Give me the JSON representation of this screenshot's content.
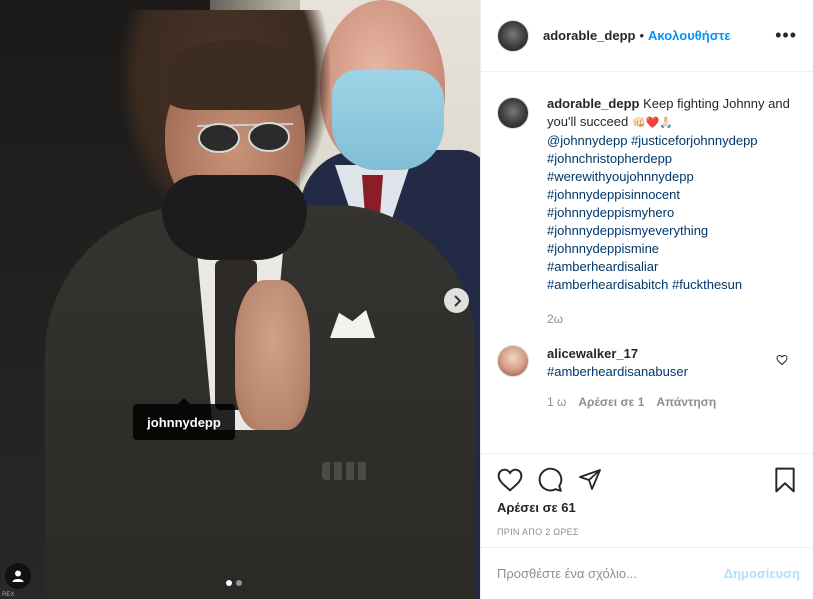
{
  "photo": {
    "tag_username": "johnnydepp",
    "next_icon": "chevron-right-icon",
    "tagged_user_icon": "user-icon",
    "carousel_total": 2,
    "carousel_current": 1,
    "credit": "REX"
  },
  "header": {
    "username": "adorable_depp",
    "separator": "•",
    "follow_label": "Ακολουθήστε",
    "more_icon": "more-options-icon",
    "more_label": "•••"
  },
  "caption": {
    "username": "adorable_depp",
    "text_start": "Keep fighting Johnny and you'll succeed",
    "emojis": "👊🏻❤️🙏🏻",
    "mention": "@johnnydepp",
    "inline_hashtag": "#justiceforjohnnydepp",
    "hashtags": [
      "#johnchristopherdepp",
      "#werewithyoujohnnydepp",
      "#johnnydeppisinnocent",
      "#johnnydeppismyhero",
      "#johnnydeppismyeverything",
      "#johnnydeppismine",
      "#amberheardisaliar"
    ],
    "last_line_tag1": "#amberheardisabitch",
    "last_line_tag2": "#fuckthesun",
    "time": "2ω"
  },
  "comment": {
    "username": "alicewalker_17",
    "text": "#amberheardisanabuser",
    "time": "1 ω",
    "likes": "Αρέσει σε 1",
    "reply": "Απάντηση"
  },
  "actions": {
    "likes_text": "Αρέσει σε 61",
    "post_time": "ΠΡΙΝ ΑΠΟ 2 ΩΡΕΣ"
  },
  "add_comment": {
    "placeholder": "Προσθέστε ένα σχόλιο...",
    "post_label": "Δημοσίευση"
  },
  "colors": {
    "link_blue": "#0095f6",
    "hashtag_blue": "#00376b",
    "muted": "#8e8e8e",
    "post_disabled": "#b2dffc"
  }
}
